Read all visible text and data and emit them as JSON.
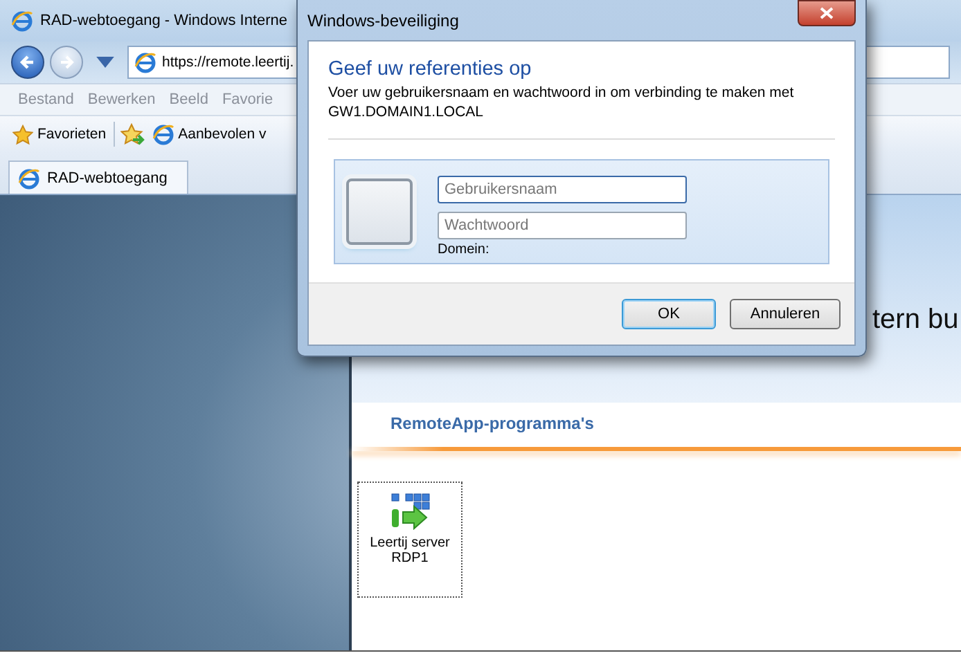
{
  "browser": {
    "title": "RAD-webtoegang - Windows Interne",
    "address": "https://remote.leertij.",
    "menu": [
      "Bestand",
      "Bewerken",
      "Beeld",
      "Favorie"
    ],
    "favorites_bar": {
      "favorites": "Favorieten",
      "suggested": "Aanbevolen v"
    },
    "tabs": [
      {
        "label": "RAD-webtoegang",
        "selected": true
      }
    ]
  },
  "page": {
    "heading_fragment": "tern bu",
    "section_title": "RemoteApp-programma's",
    "apps": [
      {
        "label": "Leertij server RDP1"
      }
    ]
  },
  "dialog": {
    "title": "Windows-beveiliging",
    "heading": "Geef uw referenties op",
    "message": "Voer uw gebruikersnaam en wachtwoord in om verbinding te maken met GW1.DOMAIN1.LOCAL",
    "fields": [
      {
        "placeholder": "Gebruikersnaam",
        "focused": true
      },
      {
        "placeholder": "Wachtwoord",
        "focused": false
      }
    ],
    "domain_label": "Domein:",
    "buttons": [
      {
        "label": "OK",
        "default": true
      },
      {
        "label": "Annuleren",
        "default": false
      }
    ]
  }
}
